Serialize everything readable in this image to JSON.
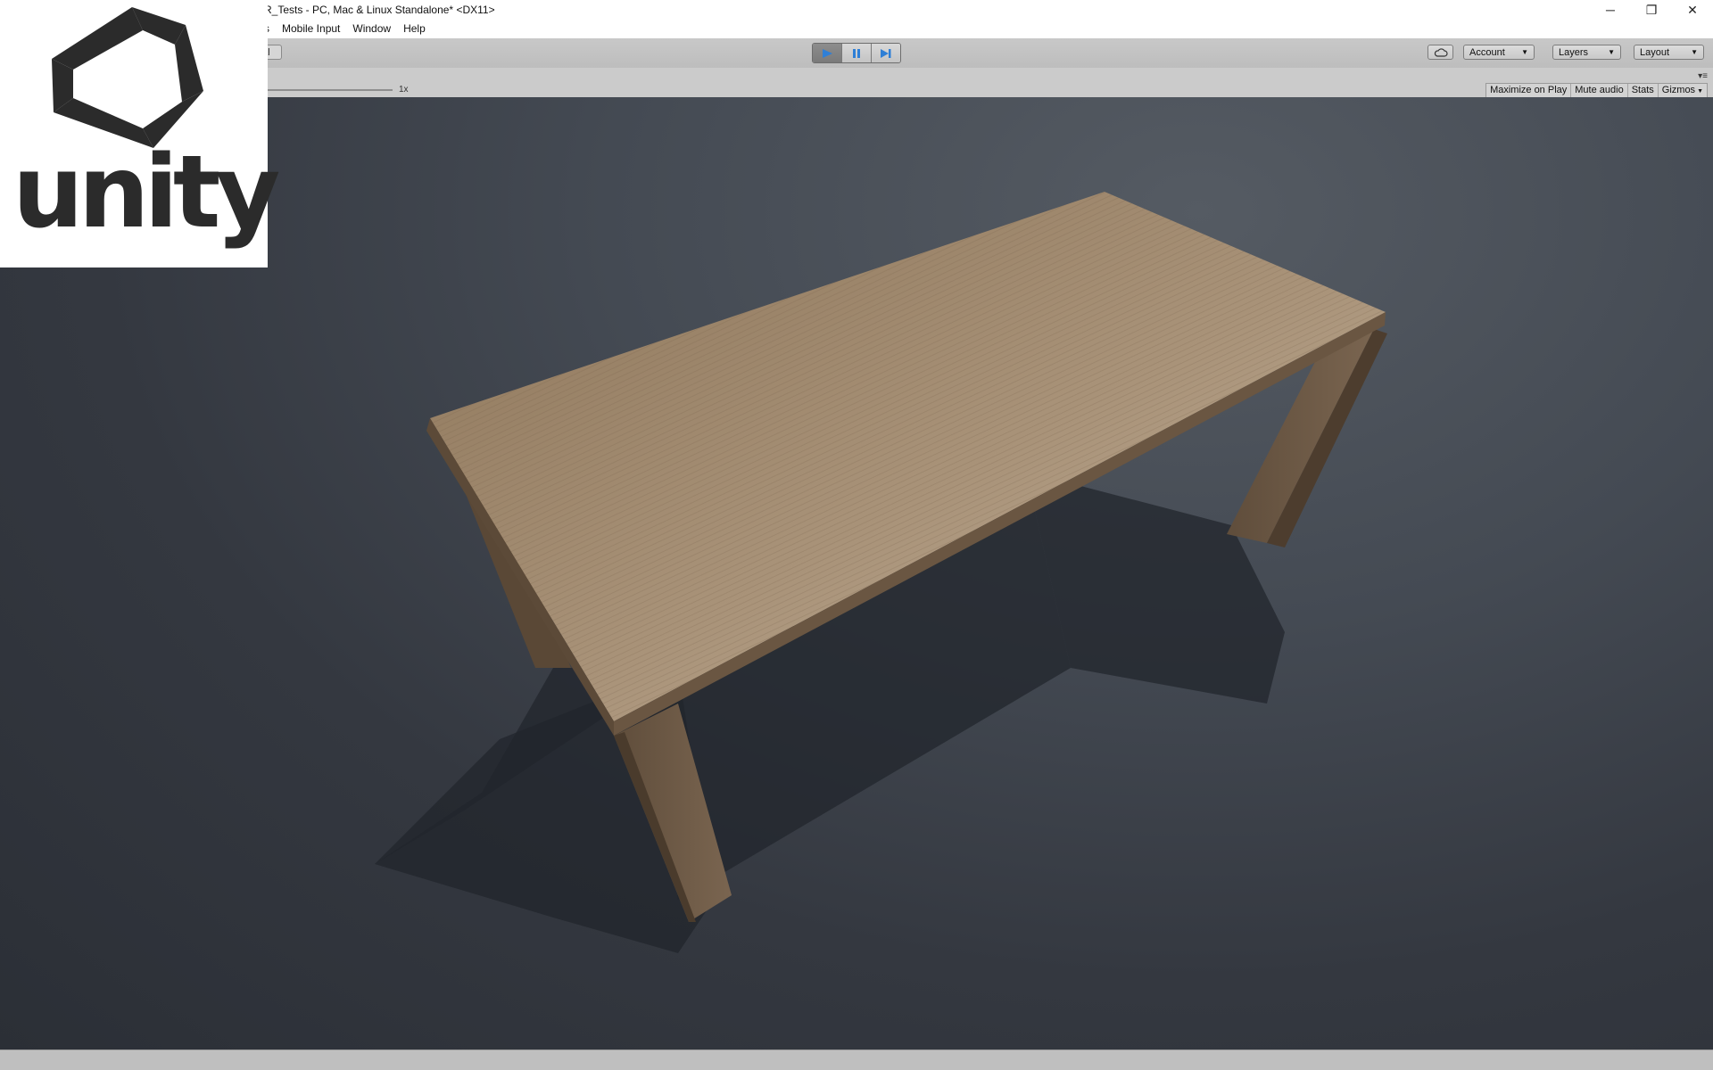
{
  "window": {
    "title": "R_Tests - PC, Mac & Linux Standalone* <DX11>",
    "controls": {
      "minimize": "─",
      "restore": "❐",
      "close": "✕"
    }
  },
  "menubar": {
    "items": [
      {
        "label": "s",
        "partial": true
      },
      {
        "label": "Mobile Input"
      },
      {
        "label": "Window"
      },
      {
        "label": "Help"
      }
    ]
  },
  "toolbar": {
    "pivot_partial_label": "al",
    "account_label": "Account",
    "layers_label": "Layers",
    "layout_label": "Layout",
    "play_state": "playing"
  },
  "game_view": {
    "scale_label": "1x",
    "buttons": {
      "maximize": "Maximize on Play",
      "mute": "Mute audio",
      "stats": "Stats",
      "gizmos": "Gizmos"
    }
  },
  "logo": {
    "text": "unity"
  },
  "colors": {
    "play_accent": "#2f7fd6",
    "wood_top": "#a48d73",
    "background_dark": "#2b2f36"
  }
}
